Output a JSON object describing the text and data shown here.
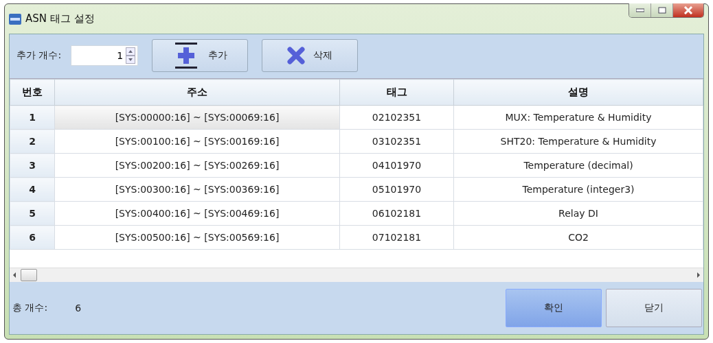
{
  "window": {
    "title": "ASN 태그 설정"
  },
  "toolbar": {
    "count_label": "추가 개수:",
    "count_value": "1",
    "buttons": [
      {
        "kind": "add",
        "label": "추가"
      },
      {
        "kind": "delete",
        "label": "삭제"
      }
    ]
  },
  "table": {
    "columns": [
      "번호",
      "주소",
      "태그",
      "설명"
    ],
    "rows": [
      {
        "cells": [
          "1",
          "[SYS:00000:16] ~ [SYS:00069:16]",
          "02102351",
          "MUX: Temperature & Humidity"
        ],
        "selected": true
      },
      {
        "cells": [
          "2",
          "[SYS:00100:16] ~ [SYS:00169:16]",
          "03102351",
          "SHT20: Temperature & Humidity"
        ],
        "selected": false
      },
      {
        "cells": [
          "3",
          "[SYS:00200:16] ~ [SYS:00269:16]",
          "04101970",
          "Temperature (decimal)"
        ],
        "selected": false
      },
      {
        "cells": [
          "4",
          "[SYS:00300:16] ~ [SYS:00369:16]",
          "05101970",
          "Temperature (integer3)"
        ],
        "selected": false
      },
      {
        "cells": [
          "5",
          "[SYS:00400:16] ~ [SYS:00469:16]",
          "06102181",
          "Relay DI"
        ],
        "selected": false
      },
      {
        "cells": [
          "6",
          "[SYS:00500:16] ~ [SYS:00569:16]",
          "07102181",
          "CO2"
        ],
        "selected": false
      }
    ]
  },
  "footer": {
    "total_label": "총 개수:",
    "total_value": "6",
    "buttons": [
      {
        "label": "확인",
        "default": true
      },
      {
        "label": "닫기",
        "default": false
      }
    ]
  }
}
